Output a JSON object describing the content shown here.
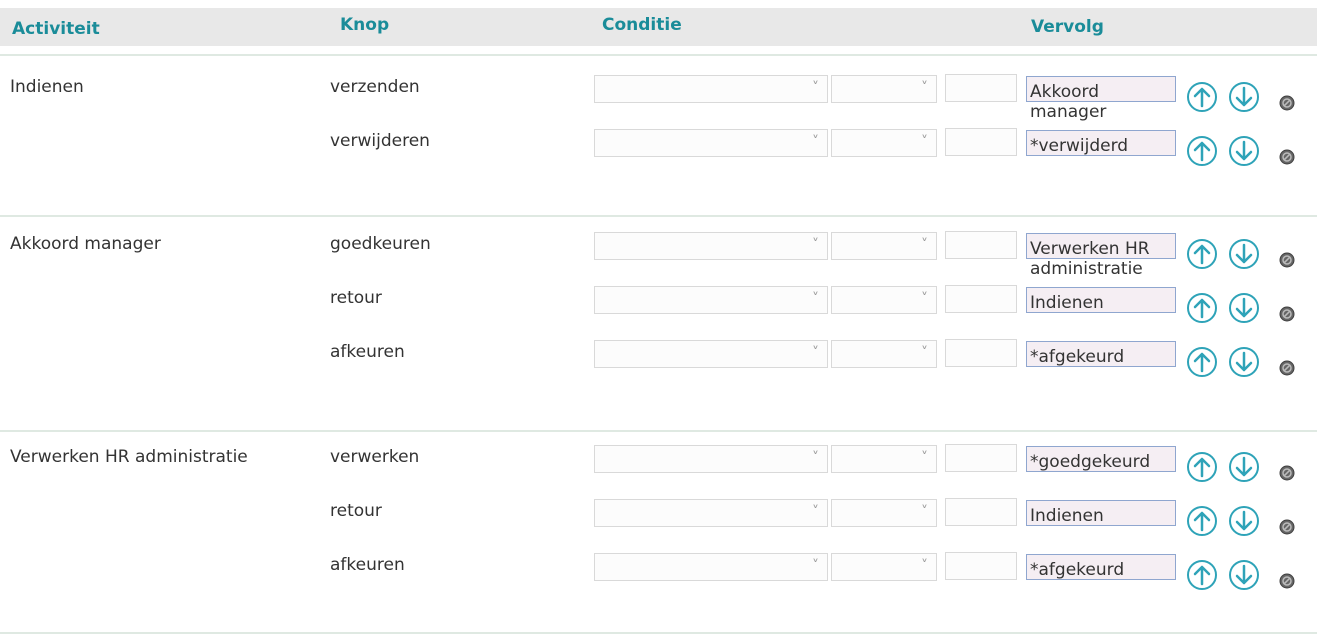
{
  "header": {
    "activiteit": "Activiteit",
    "knop": "Knop",
    "conditie": "Conditie",
    "vervolg": "Vervolg"
  },
  "groups": [
    {
      "activity": "Indienen",
      "rows": [
        {
          "knop": "verzenden",
          "vervolg": "Akkoord\nmanager"
        },
        {
          "knop": "verwijderen",
          "vervolg": "*verwijderd"
        }
      ]
    },
    {
      "activity": "Akkoord manager",
      "rows": [
        {
          "knop": "goedkeuren",
          "vervolg": "Verwerken HR\nadministratie"
        },
        {
          "knop": "retour",
          "vervolg": "Indienen"
        },
        {
          "knop": "afkeuren",
          "vervolg": "*afgekeurd"
        }
      ]
    },
    {
      "activity": "Verwerken HR administratie",
      "rows": [
        {
          "knop": "verwerken",
          "vervolg": "*goedgekeurd"
        },
        {
          "knop": "retour",
          "vervolg": "Indienen"
        },
        {
          "knop": "afkeuren",
          "vervolg": "*afgekeurd"
        }
      ]
    }
  ],
  "colors": {
    "header_text": "#1a8c99",
    "header_bg": "#e8e8e8",
    "arrow": "#2ea3b8",
    "vervolg_border": "#8fa6cf",
    "vervolg_bg": "#f5eef3"
  },
  "icons": [
    "chevron-down-icon",
    "arrow-up-icon",
    "arrow-down-icon",
    "delete-icon"
  ]
}
